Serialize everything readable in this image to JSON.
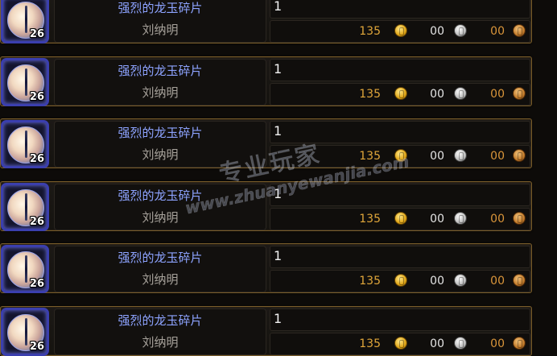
{
  "auction_list": {
    "items": [
      {
        "name": "强烈的龙玉碎片",
        "seller": "刘纳明",
        "level": "26",
        "quantity": "1",
        "gold": "135",
        "silver": "00",
        "copper": "00",
        "icon": "jade-orb-icon"
      },
      {
        "name": "强烈的龙玉碎片",
        "seller": "刘纳明",
        "level": "26",
        "quantity": "1",
        "gold": "135",
        "silver": "00",
        "copper": "00",
        "icon": "jade-orb-icon"
      },
      {
        "name": "强烈的龙玉碎片",
        "seller": "刘纳明",
        "level": "26",
        "quantity": "1",
        "gold": "135",
        "silver": "00",
        "copper": "00",
        "icon": "jade-orb-icon"
      },
      {
        "name": "强烈的龙玉碎片",
        "seller": "刘纳明",
        "level": "26",
        "quantity": "1",
        "gold": "135",
        "silver": "00",
        "copper": "00",
        "icon": "jade-orb-icon"
      },
      {
        "name": "强烈的龙玉碎片",
        "seller": "刘纳明",
        "level": "26",
        "quantity": "1",
        "gold": "135",
        "silver": "00",
        "copper": "00",
        "icon": "jade-orb-icon"
      },
      {
        "name": "强烈的龙玉碎片",
        "seller": "刘纳明",
        "level": "26",
        "quantity": "1",
        "gold": "135",
        "silver": "00",
        "copper": "00",
        "icon": "jade-orb-icon"
      }
    ]
  },
  "watermark": {
    "brand": "专业玩家",
    "url": "www.zhuanyewanjia.com"
  },
  "colors": {
    "item_name": "#8da3ff",
    "gold_amount": "#e0a63a",
    "row_border": "#7a5d2a",
    "icon_border": "#3b3fae"
  }
}
